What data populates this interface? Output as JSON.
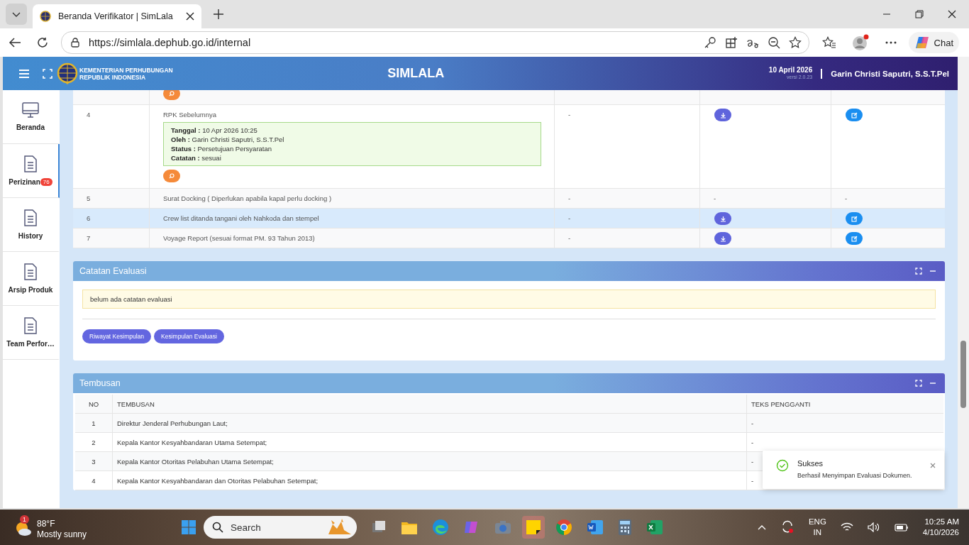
{
  "browser": {
    "tab_title": "Beranda Verifikator | SimLala",
    "url": "https://simlala.dephub.go.id/internal",
    "chat_label": "Chat"
  },
  "app_header": {
    "org_line_1": "KEMENTERIAN PERHUBUNGAN",
    "org_line_2": "REPUBLIK INDONESIA",
    "title": "SIMLALA",
    "date": "10 April 2026",
    "version": "versi 2.0.23",
    "user": "Garin Christi Saputri, S.S.T.Pel"
  },
  "sidebar": {
    "items": [
      {
        "label": "Beranda",
        "kind": "monitor",
        "selected": false
      },
      {
        "label": "Perizinan",
        "kind": "document",
        "selected": true,
        "badge": "76"
      },
      {
        "label": "History",
        "kind": "document",
        "selected": false
      },
      {
        "label": "Arsip Produk",
        "kind": "document",
        "selected": false
      },
      {
        "label": "Team Perfor…",
        "kind": "document",
        "selected": false
      }
    ]
  },
  "documents": {
    "rows": [
      {
        "search_button": true,
        "selected": false
      },
      {
        "no": "4",
        "title": "RPK Sebelumnya",
        "details": [
          {
            "label": "Tanggal :",
            "value": "10 Apr 2026 10:25"
          },
          {
            "label": "Oleh :",
            "value": "Garin Christi Saputri, S.S.T.Pel"
          },
          {
            "label": "Status :",
            "value": "Persetujuan Persyaratan"
          },
          {
            "label": "Catatan :",
            "value": "sesuai"
          }
        ],
        "search_button": true,
        "column_3": "-",
        "column_4": {
          "kind": "download"
        },
        "column_5": {
          "kind": "edit"
        },
        "selected": false
      },
      {
        "no": "5",
        "title": "Surat Docking ( Diperlukan apabila kapal perlu docking )",
        "search_button": false,
        "column_3": "-",
        "column_4": {
          "kind": "text",
          "text": "-"
        },
        "column_5": {
          "kind": "text",
          "text": "-"
        },
        "selected": false
      },
      {
        "no": "6",
        "title": "Crew list ditanda tangani oleh Nahkoda dan stempel",
        "search_button": false,
        "column_3": "-",
        "column_4": {
          "kind": "download"
        },
        "column_5": {
          "kind": "edit"
        },
        "selected": true
      },
      {
        "no": "7",
        "title": "Voyage Report (sesuai format PM. 93 Tahun 2013)",
        "search_button": false,
        "column_3": "-",
        "column_4": {
          "kind": "download"
        },
        "column_5": {
          "kind": "edit"
        },
        "selected": false
      }
    ]
  },
  "catatan_evaluasi": {
    "title": "Catatan Evaluasi",
    "note": "belum ada catatan evaluasi",
    "buttons": [
      "Riwayat Kesimpulan",
      "Kesimpulan Evaluasi"
    ]
  },
  "tembusan": {
    "title": "Tembusan",
    "columns": [
      "NO",
      "TEMBUSAN",
      "TEKS PENGGANTI"
    ],
    "rows": [
      {
        "no": "1",
        "tembusan": "Direktur Jenderal Perhubungan Laut;",
        "teks_pengganti": "-"
      },
      {
        "no": "2",
        "tembusan": "Kepala Kantor Kesyahbandaran Utama Setempat;",
        "teks_pengganti": "-"
      },
      {
        "no": "3",
        "tembusan": "Kepala Kantor Otoritas Pelabuhan Utama Setempat;",
        "teks_pengganti": "-"
      },
      {
        "no": "4",
        "tembusan": "Kepala Kantor Kesyahbandaran dan Otoritas Pelabuhan Setempat;",
        "teks_pengganti": "-"
      }
    ]
  },
  "toast": {
    "title": "Sukses",
    "message": "Berhasil Menyimpan Evaluasi Dokumen."
  },
  "taskbar": {
    "weather_badge": "1",
    "temperature": "88°F",
    "condition": "Mostly sunny",
    "search_placeholder": "Search",
    "language": "ENG",
    "region": "IN",
    "time": "10:25 AM",
    "date": "4/10/2026"
  }
}
